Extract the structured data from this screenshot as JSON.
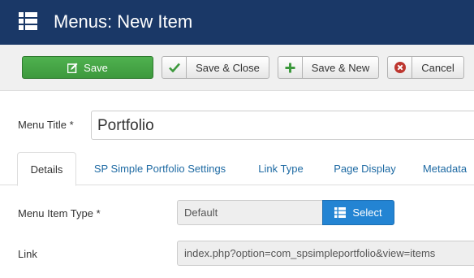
{
  "header": {
    "title": "Menus: New Item",
    "icon": "list-icon"
  },
  "toolbar": {
    "save_label": "Save",
    "save_close_label": "Save & Close",
    "save_new_label": "Save & New",
    "cancel_label": "Cancel"
  },
  "form": {
    "menu_title_label": "Menu Title *",
    "menu_title_value": "Portfolio",
    "menu_item_type_label": "Menu Item Type *",
    "menu_item_type_value": "Default",
    "select_label": "Select",
    "link_label": "Link",
    "link_value": "index.php?option=com_spsimpleportfolio&view=items"
  },
  "tabs": [
    {
      "label": "Details",
      "active": true
    },
    {
      "label": "SP Simple Portfolio Settings",
      "active": false
    },
    {
      "label": "Link Type",
      "active": false
    },
    {
      "label": "Page Display",
      "active": false
    },
    {
      "label": "Metadata",
      "active": false
    }
  ],
  "colors": {
    "header_bg": "#1a3867",
    "save_green": "#46a546",
    "select_blue": "#2384d3",
    "tab_link": "#1e6aa3",
    "cancel_red": "#bd362f"
  }
}
